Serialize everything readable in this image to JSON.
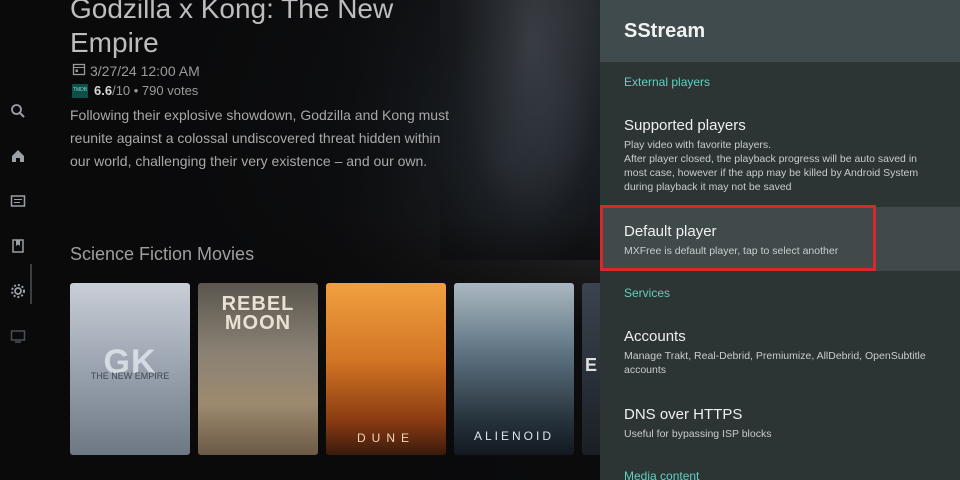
{
  "hero": {
    "title": "Godzilla x Kong: The New Empire",
    "date": "3/27/24 12:00 AM",
    "rating_value": "6.6",
    "rating_rest": "/10 • 790 votes",
    "tmdb_badge": "TMDB",
    "overview": "Following their explosive showdown, Godzilla and Kong must reunite against a colossal undiscovered threat hidden within our world, challenging their very existence – and our own."
  },
  "nav": {
    "items": [
      {
        "icon": "search-icon"
      },
      {
        "icon": "home-icon"
      },
      {
        "icon": "list-icon"
      },
      {
        "icon": "bookmark-icon"
      },
      {
        "icon": "gear-icon"
      },
      {
        "icon": "screen-icon"
      }
    ]
  },
  "row": {
    "title": "Science Fiction Movies",
    "posters": [
      {
        "title": "GK",
        "subtitle": "THE NEW EMPIRE"
      },
      {
        "title": "REBEL MOON",
        "subtitle": ""
      },
      {
        "title": "DUNE",
        "subtitle": ""
      },
      {
        "title": "ALIENOID",
        "subtitle": ""
      },
      {
        "title": "E",
        "subtitle": ""
      }
    ]
  },
  "panel": {
    "title": "SStream",
    "sections": {
      "external_players": "External players",
      "services": "Services",
      "media_content": "Media content"
    },
    "prefs": {
      "supported_players": {
        "title": "Supported players",
        "summary": "Play video with favorite players.\nAfter player closed, the playback progress will be auto saved in most case, however if the app may be killed by Android System during playback it may not be saved"
      },
      "default_player": {
        "title": "Default player",
        "summary": "MXFree is default player, tap to select another"
      },
      "accounts": {
        "title": "Accounts",
        "summary": "Manage Trakt, Real-Debrid, Premiumize, AllDebrid, OpenSubtitle accounts"
      },
      "dns": {
        "title": "DNS over HTTPS",
        "summary": "Useful for bypassing ISP blocks"
      }
    }
  },
  "colors": {
    "panel_bg": "#2c3434",
    "panel_header": "#3f4b4c",
    "section_accent": "#5fd0c0",
    "highlight": "#d42a2a"
  }
}
